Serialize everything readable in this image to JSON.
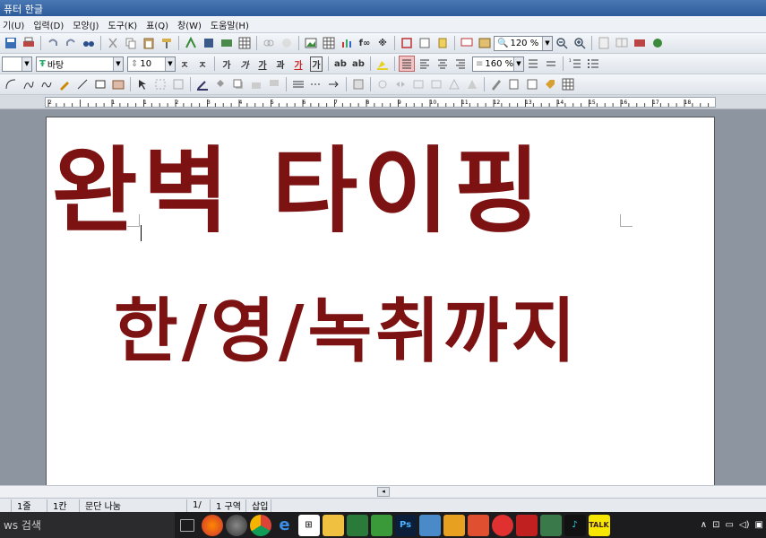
{
  "window": {
    "title": "퓨터 한글"
  },
  "menu": [
    "기(U)",
    "입력(D)",
    "모양(J)",
    "도구(K)",
    "표(Q)",
    "창(W)",
    "도움말(H)"
  ],
  "toolbar2": {
    "style_combo": "",
    "font_combo": "바탕",
    "font_size": "10",
    "line_spacing": "160 %"
  },
  "toolbar1": {
    "zoom": "120 %"
  },
  "document": {
    "line1": "완벽 타이핑",
    "line2": "한/영/녹취까지"
  },
  "statusbar": {
    "line": "1줄",
    "column": "1칸",
    "paragraph": "문단 나눔",
    "page": "1/",
    "section": "1 구역",
    "mode": "삽입"
  },
  "taskbar": {
    "search_placeholder": "ws 검색",
    "icons": [
      "task-view",
      "firefox",
      "chrome-like",
      "chrome",
      "edge",
      "store",
      "explorer",
      "app",
      "app",
      "photoshop",
      "app",
      "app",
      "app",
      "app",
      "app",
      "app",
      "app",
      "tiktok",
      "kakaotalk"
    ]
  },
  "ruler": {
    "ticks": [
      "2",
      "1",
      "1",
      "2",
      "3",
      "4",
      "5",
      "6",
      "7",
      "8",
      "9",
      "10",
      "11",
      "12",
      "13",
      "14",
      "15",
      "16",
      "17",
      "18"
    ]
  }
}
